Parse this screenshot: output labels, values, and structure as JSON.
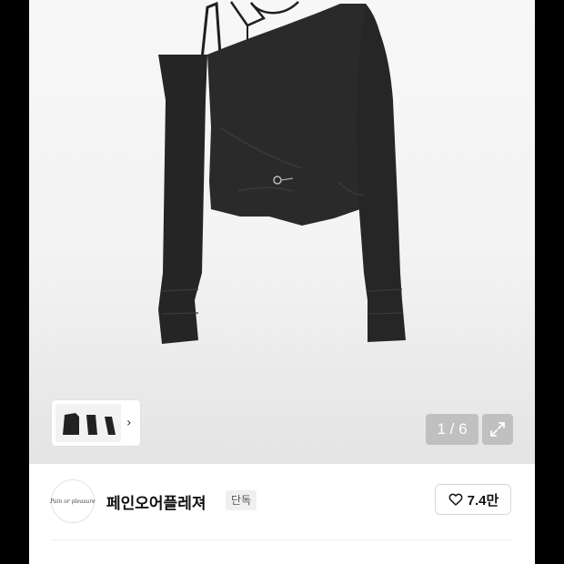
{
  "gallery": {
    "counter": "1 / 6",
    "thumbnail_next": "›"
  },
  "brand": {
    "logo_text": "Pain or pleasure",
    "name": "페인오어플레져",
    "badge": "단독",
    "likes": "7.4만"
  },
  "icons": {
    "expand": "expand-icon",
    "heart": "heart-icon",
    "chevron": "chevron-right-icon"
  }
}
